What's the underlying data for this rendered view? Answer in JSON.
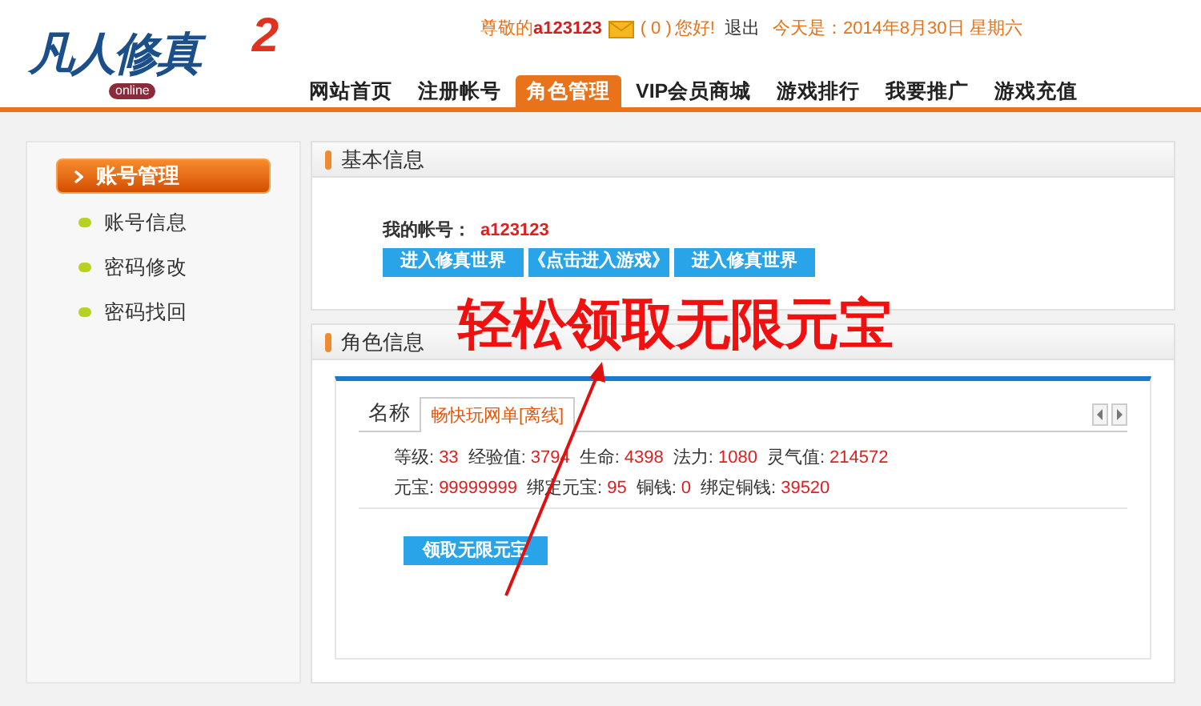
{
  "logo": {
    "title": "凡人修真",
    "subtitle": "online",
    "number": "2"
  },
  "user_bar": {
    "greeting": "尊敬的",
    "username": "a123123",
    "mail_count": "( 0 )",
    "hello": "您好!",
    "logout": "退出",
    "date": "今天是：2014年8月30日 星期六"
  },
  "nav": [
    {
      "label": "网站首页",
      "selected": false
    },
    {
      "label": "注册帐号",
      "selected": false
    },
    {
      "label": "角色管理",
      "selected": true
    },
    {
      "label": "VIP会员商城",
      "selected": false
    },
    {
      "label": "游戏排行",
      "selected": false
    },
    {
      "label": "我要推广",
      "selected": false
    },
    {
      "label": "游戏充值",
      "selected": false
    }
  ],
  "sidebar": {
    "heading": "账号管理",
    "items": [
      "账号信息",
      "密码修改",
      "密码找回"
    ]
  },
  "basic_info": {
    "title": "基本信息",
    "account_label": "我的帐号：",
    "account": "a123123",
    "buttons": [
      "进入修真世界",
      "《点击进入游戏》",
      "进入修真世界"
    ]
  },
  "role_info": {
    "title": "角色信息",
    "tabs": [
      {
        "label": "名称",
        "selected": false
      },
      {
        "label": "畅快玩网单[离线]",
        "selected": true
      }
    ],
    "stats": [
      [
        {
          "label": "等级:",
          "value": "33"
        },
        {
          "label": "经验值:",
          "value": "3794"
        },
        {
          "label": "生命:",
          "value": "4398"
        },
        {
          "label": "法力:",
          "value": "1080"
        },
        {
          "label": "灵气值:",
          "value": "214572"
        }
      ],
      [
        {
          "label": "元宝:",
          "value": "99999999"
        },
        {
          "label": "绑定元宝:",
          "value": "95"
        },
        {
          "label": "铜钱:",
          "value": "0"
        },
        {
          "label": "绑定铜钱:",
          "value": "39520"
        }
      ]
    ],
    "claim_button": "领取无限元宝"
  },
  "annotation": "轻松领取无限元宝"
}
